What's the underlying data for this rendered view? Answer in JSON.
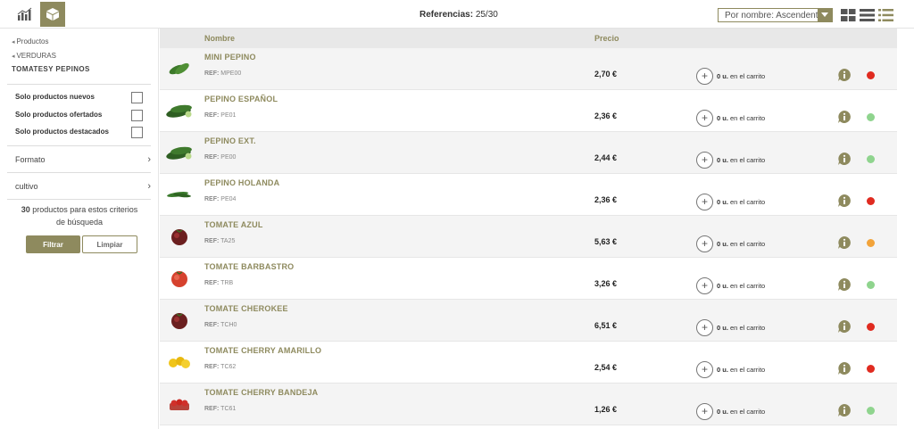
{
  "header": {
    "refs_label": "Referencias:",
    "refs_value": "25/30",
    "sort_value": "Por nombre: Ascendente"
  },
  "sidebar": {
    "breadcrumbs": [
      "Productos",
      "VERDURAS"
    ],
    "category": "TOMATESY PEPINOS",
    "checks": [
      "Solo productos nuevos",
      "Solo productos ofertados",
      "Solo productos destacados"
    ],
    "filters": [
      "Formato",
      "cultivo"
    ],
    "count": "30",
    "count_text_1": "productos para estos criterios",
    "count_text_2": "de búsqueda",
    "filtrar": "Filtrar",
    "limpiar": "Limpiar"
  },
  "table": {
    "col_nombre": "Nombre",
    "col_precio": "Precio",
    "ref_prefix": "REF:",
    "cart_units": "0 u.",
    "cart_text": "en el carrito"
  },
  "colors": {
    "accent": "#8e8a5e",
    "red": "#e02b20",
    "green": "#8fd48e",
    "orange": "#f2a33a"
  },
  "products": [
    {
      "name": "MINI PEPINO",
      "ref": "MPE00",
      "price": "2,70 €",
      "status": "red",
      "kind": "cucumber-small"
    },
    {
      "name": "PEPINO ESPAÑOL",
      "ref": "PE01",
      "price": "2,36 €",
      "status": "green",
      "kind": "cucumber"
    },
    {
      "name": "PEPINO EXT.",
      "ref": "PE00",
      "price": "2,44 €",
      "status": "green",
      "kind": "cucumber"
    },
    {
      "name": "PEPINO HOLANDA",
      "ref": "PE04",
      "price": "2,36 €",
      "status": "red",
      "kind": "cucumber-thin"
    },
    {
      "name": "TOMATE AZUL",
      "ref": "TA25",
      "price": "5,63 €",
      "status": "orange",
      "kind": "tomato-dark"
    },
    {
      "name": "TOMATE BARBASTRO",
      "ref": "TRB",
      "price": "3,26 €",
      "status": "green",
      "kind": "tomato"
    },
    {
      "name": "TOMATE CHEROKEE",
      "ref": "TCH0",
      "price": "6,51 €",
      "status": "red",
      "kind": "tomato-dark"
    },
    {
      "name": "TOMATE CHERRY AMARILLO",
      "ref": "TC62",
      "price": "2,54 €",
      "status": "red",
      "kind": "cherry-yellow"
    },
    {
      "name": "TOMATE CHERRY BANDEJA",
      "ref": "TC61",
      "price": "1,26 €",
      "status": "green",
      "kind": "cherry-tray"
    }
  ]
}
